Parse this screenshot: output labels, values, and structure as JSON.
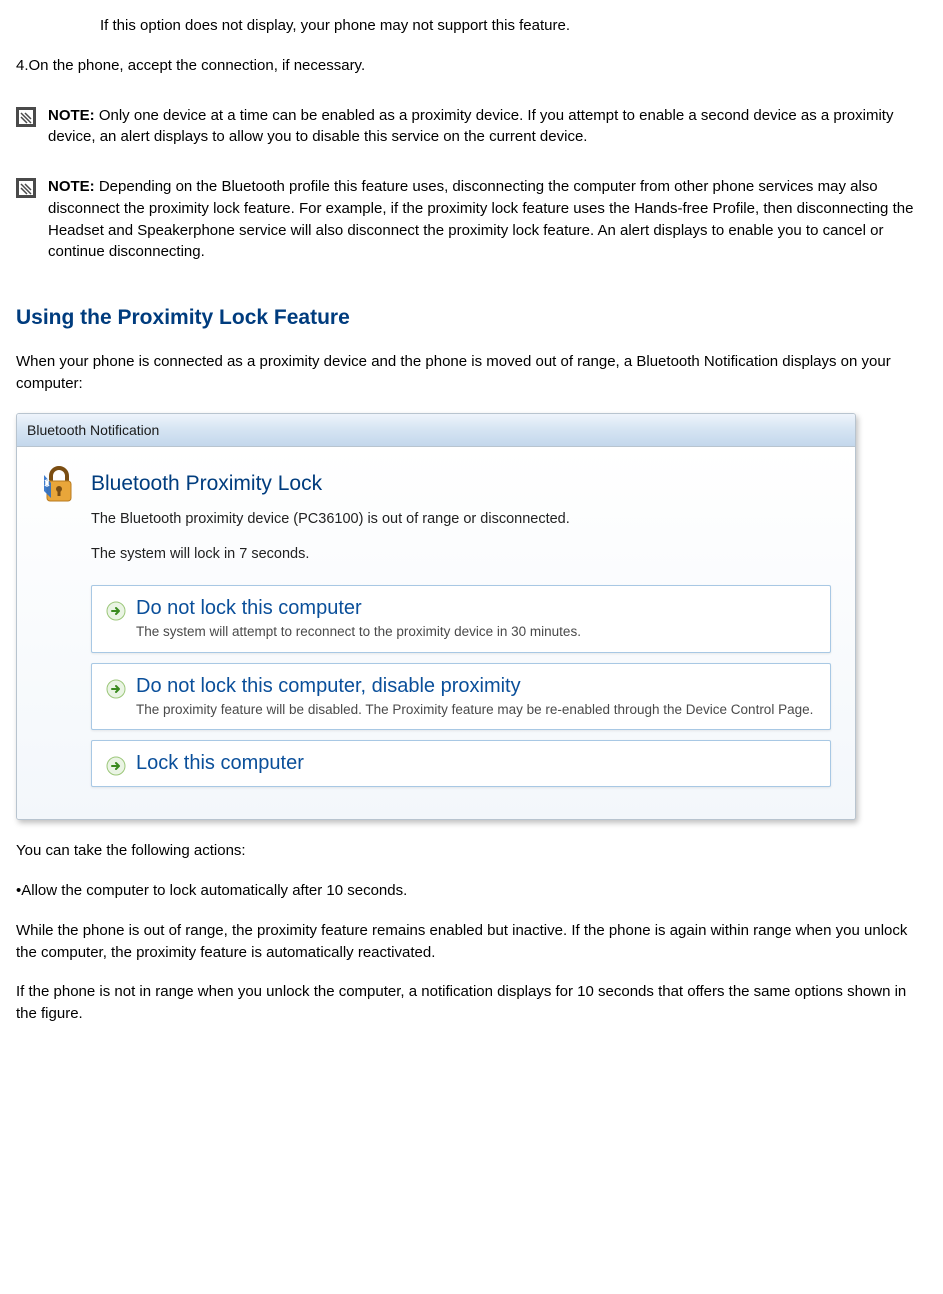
{
  "top_indent_text": "If this option does not display, your phone may not support this feature.",
  "step4_prefix": "4.",
  "step4_text": "On the phone, accept the connection, if necessary.",
  "note_label": "NOTE:",
  "note1_text": " Only one device at a time can be enabled as a proximity device. If you attempt to enable a second device as a proximity device, an alert displays to allow you to disable this service on the current device.",
  "note2_text": " Depending on the Bluetooth profile this feature uses, disconnecting the computer from other phone services may also disconnect the proximity lock feature. For example, if the proximity lock feature uses the Hands-free Profile, then disconnecting the Headset and Speakerphone service will also disconnect the proximity lock feature. An alert displays to enable you to cancel or continue disconnecting.",
  "section_heading": "Using the Proximity Lock Feature",
  "intro_para": "When your phone is connected as a proximity device and the phone is moved out of range, a Bluetooth Notification displays on your computer:",
  "dialog": {
    "window_title": "Bluetooth Notification",
    "title": "Bluetooth Proximity Lock",
    "msg1": "The Bluetooth proximity device (PC36100) is out of range or disconnected.",
    "msg2": "The system will lock in 7 seconds.",
    "options": [
      {
        "title": "Do not lock this computer",
        "desc": "The system will attempt to reconnect to the proximity device in 30 minutes."
      },
      {
        "title": "Do not lock this computer, disable proximity",
        "desc": "The proximity feature will be disabled.  The Proximity feature may be re-enabled through the Device Control Page."
      },
      {
        "title": "Lock this computer",
        "desc": ""
      }
    ]
  },
  "actions_intro": "You can take the following actions:",
  "bullet_prefix": "•",
  "bullet_text": "Allow the computer to lock automatically after 10 seconds.",
  "para_after1": "While the phone is out of range, the proximity feature remains enabled but inactive. If the phone is again within range when you unlock the computer, the proximity feature is automatically reactivated.",
  "para_after2": "If the phone is not in range when you unlock the computer, a notification displays for 10 seconds that offers the same options shown in the figure."
}
